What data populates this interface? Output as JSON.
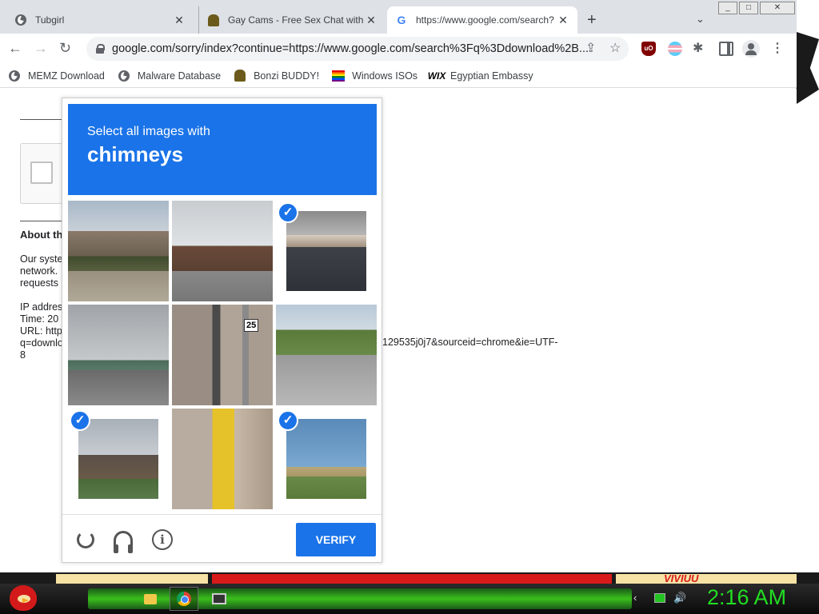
{
  "tabs": [
    {
      "title": "Tubgirl",
      "icon": "globe-icon",
      "close": "✕"
    },
    {
      "title": "Gay Cams - Free Sex Chat with Se",
      "icon": "gorilla-icon",
      "close": "✕"
    },
    {
      "title": "https://www.google.com/search?",
      "icon": "google-icon",
      "close": "✕"
    }
  ],
  "newtab": "+",
  "omnibox": {
    "url": "google.com/sorry/index?continue=https://www.google.com/search%3Fq%3Ddownload%2B..."
  },
  "bookmarks": [
    {
      "label": "MEMZ Download",
      "icon": "globe-icon"
    },
    {
      "label": "Malware Database",
      "icon": "globe-icon"
    },
    {
      "label": "Bonzi BUDDY!",
      "icon": "gorilla-icon"
    },
    {
      "label": "Windows ISOs",
      "icon": "rainbow-flag-icon"
    },
    {
      "label": "Egyptian Embassy",
      "icon": "wix-icon",
      "icon_text": "WIX"
    }
  ],
  "page": {
    "about": "About th",
    "lines": [
      "Our syste",
      "network.",
      "requests",
      "",
      "IP addres",
      "Time: 20",
      "URL: http",
      "q=downlo",
      "8"
    ],
    "url_tail": "129535j0j7&sourceid=chrome&ie=UTF-"
  },
  "captcha": {
    "instruction": "Select all images with",
    "target": "chimneys",
    "tiles": [
      {
        "scene": "city street with palm trees",
        "selected": false
      },
      {
        "scene": "house with roof",
        "selected": false
      },
      {
        "scene": "roof with chimney",
        "selected": true
      },
      {
        "scene": "highway bridge",
        "selected": false
      },
      {
        "scene": "utility pole and sign",
        "selected": false
      },
      {
        "scene": "rural road",
        "selected": false
      },
      {
        "scene": "house",
        "selected": true
      },
      {
        "scene": "fire hydrant",
        "selected": false
      },
      {
        "scene": "sky and overpass",
        "selected": true
      }
    ],
    "check": "✓",
    "verify": "VERIFY",
    "info_glyph": "i"
  },
  "sign_text": "25",
  "wallpaper_text": "VIVIUU",
  "clock": "2:16 AM"
}
